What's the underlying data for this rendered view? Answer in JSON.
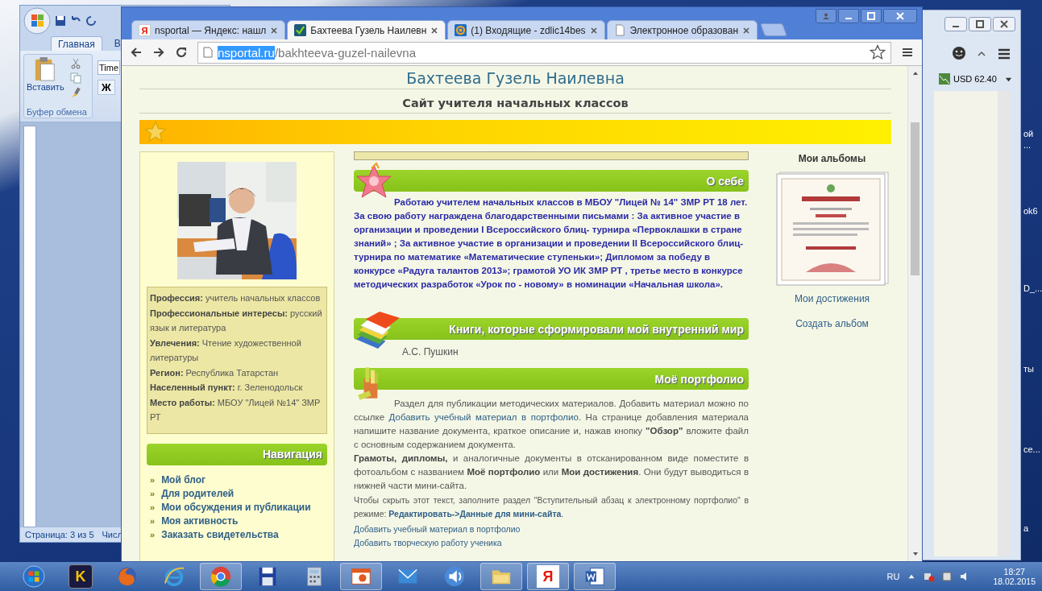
{
  "word_window": {
    "ribbon_tabs": [
      {
        "label": "Главная",
        "selected": true
      },
      {
        "label": "В",
        "selected": false
      }
    ],
    "paste_label": "Вставить",
    "group_label": "Буфер обмена",
    "font_field": "Time",
    "bold_button": "Ж",
    "status_bar": [
      "Страница: 3 из 5",
      "Числ"
    ]
  },
  "side_window": {
    "currency": "USD 62.40"
  },
  "desktop_labels": [
    "ой",
    "...",
    "ok6",
    "D_...",
    "ты",
    "се...",
    "а"
  ],
  "browser": {
    "tabs": [
      {
        "title": "nsportal — Яндекс: нашл",
        "kind": "letter",
        "glyph": "Я",
        "selected": false
      },
      {
        "title": "Бахтеева Гузель Наилевн",
        "kind": "check",
        "selected": true
      },
      {
        "title": "(1) Входящие - zdlic14bes",
        "kind": "ring",
        "selected": false
      },
      {
        "title": "Электронное образован",
        "kind": "page",
        "selected": false
      }
    ],
    "url_host": "nsportal.ru",
    "url_path": "/bakhteeva-guzel-nailevna"
  },
  "page": {
    "title": "Бахтеева Гузель Наилевна",
    "subtitle": "Сайт учителя начальных классов",
    "profile": [
      {
        "label": "Профессия:",
        "value": "учитель начальных классов"
      },
      {
        "label": "Профессиональные интересы:",
        "value": "русский язык и литература"
      },
      {
        "label": "Увлечения:",
        "value": "Чтение художественной литературы"
      },
      {
        "label": "Регион:",
        "value": "Республика Татарстан"
      },
      {
        "label": "Населенный пункт:",
        "value": "г. Зеленодольск"
      },
      {
        "label": "Место работы:",
        "value": "МБОУ \"Лицей №14\" ЗМР РТ"
      }
    ],
    "navigation": {
      "title": "Навигация",
      "bullet": "»",
      "items": [
        "Мой блог",
        "Для родителей",
        "Мои обсуждения и публикации",
        "Моя активность",
        "Заказать свидетельства"
      ]
    },
    "about": {
      "title": "О себе",
      "text": "Работаю учителем начальных классов в МБОУ \"Лицей № 14\" ЗМР РТ 18 лет. За свою работу награждена благодарственными письмами : За активное участие в организации и проведении I Всероссийского блиц- турнира «Первоклашки в стране знаний» ; За активное участие в организации и проведении II Всероссийского блиц-турнира по математике «Математические ступеньки»; Дипломом за победу в конкурсе «Радуга талантов 2013»; грамотой УО ИК ЗМР РТ , третье место в конкурсе методических разработок «Урок по - новому» в номинации «Начальная школа»."
    },
    "books": {
      "title": "Книги, которые сформировали мой внутренний мир",
      "items": [
        "А.С. Пушкин"
      ]
    },
    "portfolio": {
      "title": "Моё портфолио",
      "intro_before": "Раздел для публикации методических материалов. Добавить материал можно по ссылке",
      "intro_link": "Добавить учебный материал в портфолио",
      "intro_after": ". На странице добавления материала напишите название документа, краткое описание и, нажав кнопку **\"Обзор\"** вложите файл с основным содержанием документа.",
      "note": "**Грамоты, дипломы,** и аналогичные документы в отсканированном виде поместите в фотоальбом с названием **Моё портфолио** или **Мои достижения**. Они будут выводиться в нижней части мини-сайта.",
      "hint_before": "Чтобы скрыть этот текст, заполните раздел \"Вступительный абзац к электронному портфолио\" в режиме:",
      "hint_link": "Редактировать->Данные для мини-сайта",
      "hint_after": ".",
      "links": [
        "Добавить учебный материал в портфолио",
        "Добавить творческую работу ученика"
      ]
    },
    "albums": {
      "title": "Мои альбомы",
      "caption": "Мои достижения",
      "create": "Создать альбом"
    }
  },
  "taskbar": {
    "apps": [
      {
        "kind": "start",
        "running": false
      },
      {
        "kind": "letter",
        "glyph": "K",
        "running": false
      },
      {
        "kind": "firefox",
        "running": false
      },
      {
        "kind": "ie",
        "running": false
      },
      {
        "kind": "chrome",
        "running": true
      },
      {
        "kind": "floppy",
        "running": false
      },
      {
        "kind": "calculator",
        "running": false
      },
      {
        "kind": "presentation",
        "running": true
      },
      {
        "kind": "mail",
        "running": false
      },
      {
        "kind": "speaker",
        "running": false
      },
      {
        "kind": "folder",
        "running": true
      },
      {
        "kind": "yandex",
        "glyph": "Я",
        "running": true
      },
      {
        "kind": "word",
        "running": true
      }
    ],
    "language": "RU",
    "time": "18:27",
    "date": "18.02.2015"
  }
}
